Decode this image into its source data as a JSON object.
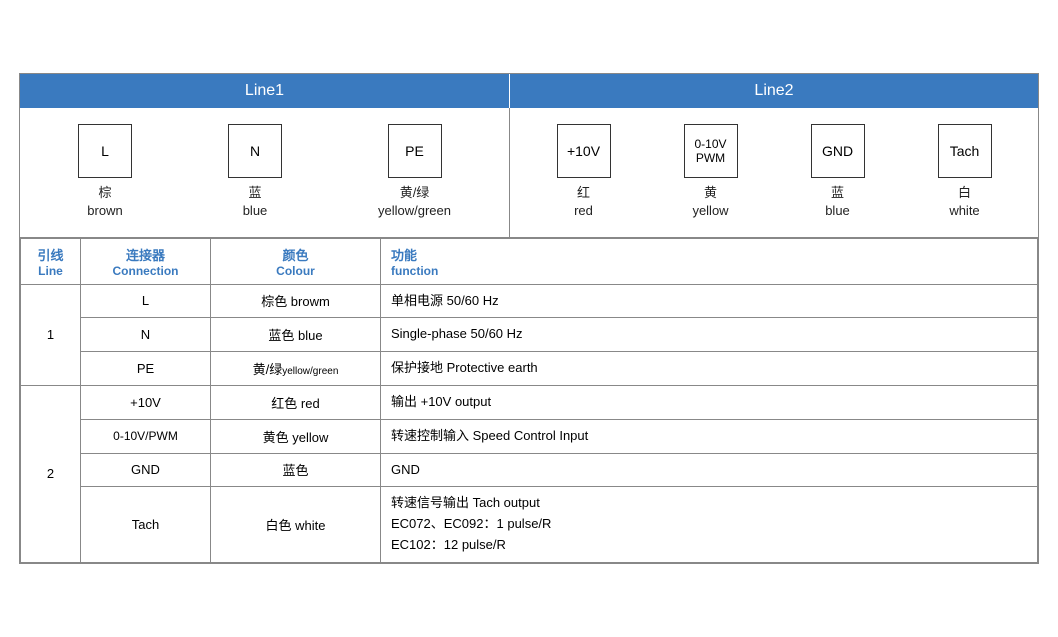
{
  "header": {
    "line1_label": "Line1",
    "line2_label": "Line2"
  },
  "line1_connectors": [
    {
      "box_text": "L",
      "zh": "棕",
      "en": "brown"
    },
    {
      "box_text": "N",
      "zh": "蓝",
      "en": "blue"
    },
    {
      "box_text": "PE",
      "zh": "黄/绿",
      "en": "yellow/green"
    }
  ],
  "line2_connectors": [
    {
      "box_text": "+10V",
      "zh": "红",
      "en": "red"
    },
    {
      "box_text": "0-10V\nPWM",
      "zh": "黄",
      "en": "yellow"
    },
    {
      "box_text": "GND",
      "zh": "蓝",
      "en": "blue"
    },
    {
      "box_text": "Tach",
      "zh": "白",
      "en": "white"
    }
  ],
  "table": {
    "columns": [
      {
        "zh": "引线",
        "en": "Line"
      },
      {
        "zh": "连接器",
        "en": "Connection"
      },
      {
        "zh": "颜色",
        "en": "Colour"
      },
      {
        "zh": "功能",
        "en": "function"
      }
    ],
    "rows": [
      {
        "line": "1",
        "rowspan": 3,
        "entries": [
          {
            "conn": "L",
            "color": "棕色 browm",
            "func": "单相电源 50/60 Hz"
          },
          {
            "conn": "N",
            "color": "蓝色 blue",
            "func": "Single-phase 50/60 Hz"
          },
          {
            "conn": "PE",
            "color": "黄/绿yellow/green",
            "func": "保护接地 Protective earth"
          }
        ]
      },
      {
        "line": "2",
        "rowspan": 4,
        "entries": [
          {
            "conn": "+10V",
            "color": "红色 red",
            "func": "输出 +10V output"
          },
          {
            "conn": "0-10V/PWM",
            "color": "黄色 yellow",
            "func": "转速控制输入 Speed Control Input"
          },
          {
            "conn": "GND",
            "color": "蓝色",
            "func": "GND"
          },
          {
            "conn": "Tach",
            "color": "白色 white",
            "func_lines": [
              "转速信号输出 Tach output",
              "EC072、EC092：1 pulse/R",
              "EC102：12 pulse/R"
            ]
          }
        ]
      }
    ]
  }
}
